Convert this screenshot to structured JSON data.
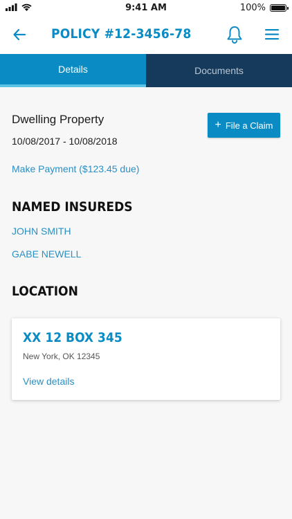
{
  "status_bar": {
    "time": "9:41 AM",
    "battery_text": "100%",
    "battery_level": 1.0
  },
  "header": {
    "title": "POLICY #12-3456-78",
    "back_icon": "arrow-left-icon",
    "bell_icon": "bell-icon",
    "menu_icon": "hamburger-menu-icon"
  },
  "tabs": [
    {
      "label": "Details",
      "active": true
    },
    {
      "label": "Documents",
      "active": false
    }
  ],
  "policy": {
    "property_type": "Dwelling Property",
    "dates": "10/08/2017 - 10/08/2018",
    "file_claim_label": "File a Claim",
    "make_payment_label": "Make Payment ($123.45 due)"
  },
  "named_insureds": {
    "heading": "NAMED INSUREDS",
    "items": [
      "JOHN SMITH",
      "GABE NEWELL"
    ]
  },
  "location": {
    "heading": "LOCATION",
    "name": "XX 12 BOX 345",
    "address": "New York, OK 12345",
    "view_details_label": "View details"
  },
  "colors": {
    "brand_blue": "#0a8bc3",
    "dark_navy": "#163a5b",
    "tab_indicator": "#5cc2e6",
    "link_blue": "#2a8fc3"
  }
}
